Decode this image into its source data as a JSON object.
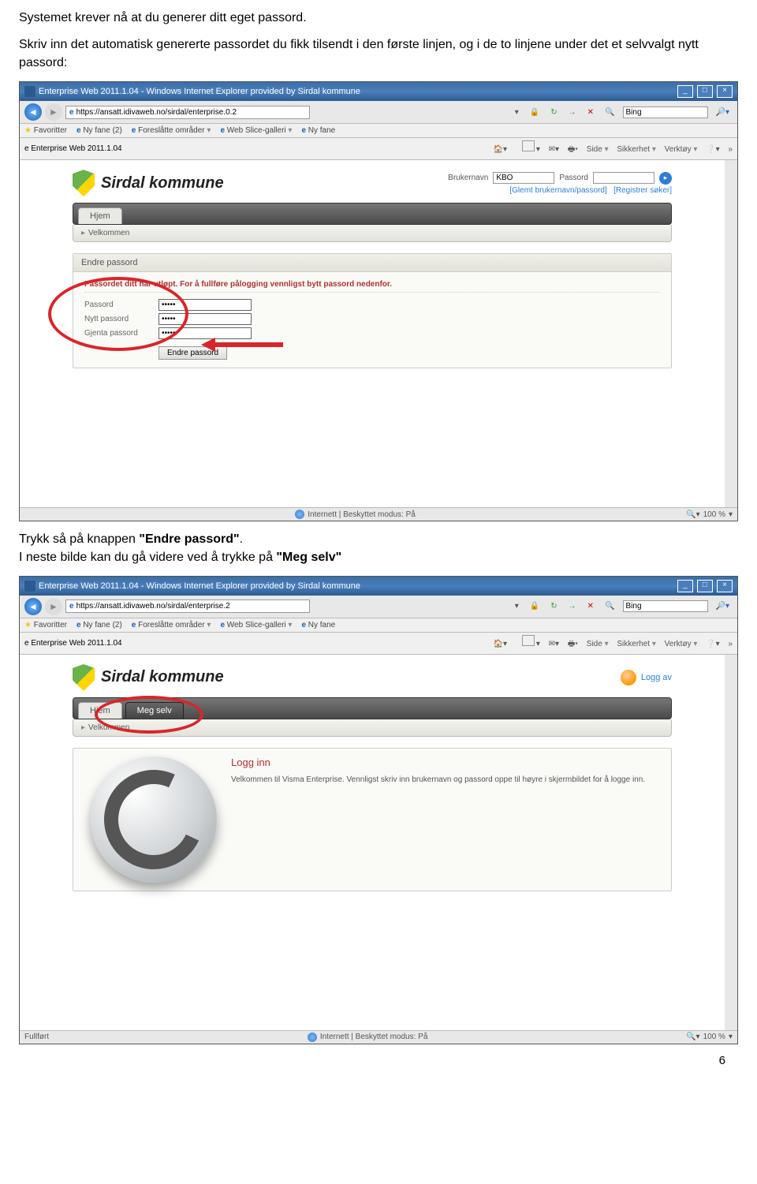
{
  "doc": {
    "intro1": "Systemet krever nå at du generer ditt eget passord.",
    "intro2a": "Skriv inn det automatisk genererte passordet du fikk tilsendt i den første linjen, og i de to linjene under det et selvvalgt nytt passord:",
    "mid1a": "Trykk så på knappen ",
    "mid1b": "\"Endre passord\"",
    "mid1c": ".",
    "mid2a": "I neste bilde kan du gå videre ved å trykke på ",
    "mid2b": "\"Meg selv\"",
    "pageNum": "6"
  },
  "browser": {
    "title": "Enterprise Web 2011.1.04 - Windows Internet Explorer provided by Sirdal kommune",
    "url1": "https://ansatt.idivaweb.no/sirdal/enterprise.0.2",
    "url2": "https://ansatt.idivaweb.no/sirdal/enterprise.2",
    "searchEngine": "Bing",
    "fav": "Favoritter",
    "favitems": {
      "nyfane2": "Ny fane (2)",
      "foreslatte": "Foreslåtte områder",
      "slicegalleri": "Web Slice-galleri",
      "nyfane": "Ny fane"
    },
    "tabTitle": "Enterprise Web 2011.1.04",
    "tools": {
      "side": "Side",
      "sikkerhet": "Sikkerhet",
      "verktoy": "Verktøy"
    },
    "status": {
      "fullfort": "Fullført",
      "internet": "Internett | Beskyttet modus: På",
      "zoom": "100 %"
    }
  },
  "site": {
    "name": "Sirdal kommune",
    "login": {
      "brukerLabel": "Brukernavn",
      "brukerValue": "KBO",
      "passLabel": "Passord"
    },
    "links": {
      "glemt": "[Glemt brukernavn/passord]",
      "registrer": "[Registrer søker]"
    },
    "tabs": {
      "hjem": "Hjem",
      "megselv": "Meg selv"
    },
    "sub": {
      "velkommen": "Velkommen"
    },
    "loggav": "Logg av"
  },
  "panel1": {
    "title": "Endre passord",
    "expired": "Passordet ditt har utløpt. For å fullføre pålogging vennligst bytt passord nedenfor.",
    "rows": {
      "passord": "Passord",
      "nytt": "Nytt passord",
      "gjenta": "Gjenta passord"
    },
    "values": {
      "passord": "●●●●●",
      "nytt": "●●●●●",
      "gjenta": "●●●●●"
    },
    "btn": "Endre passord"
  },
  "panel2": {
    "title": "Logg inn",
    "text": "Velkommen til Visma Enterprise. Vennligst skriv inn brukernavn og passord oppe til høyre i skjermbildet for å logge inn."
  }
}
